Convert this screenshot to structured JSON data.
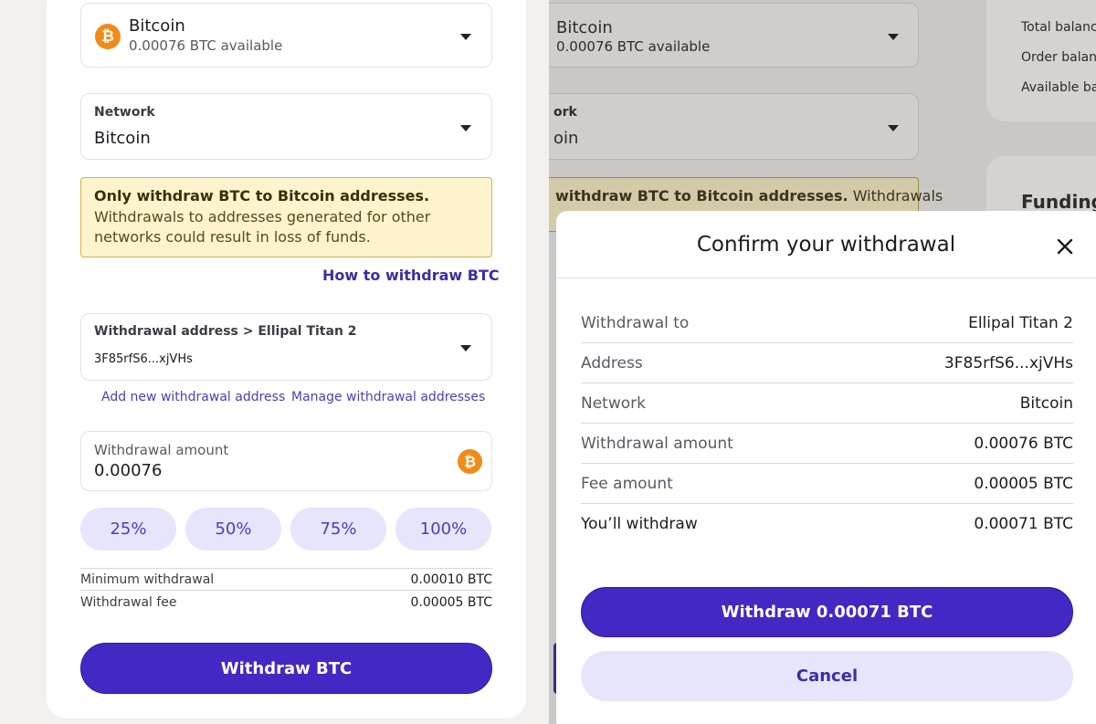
{
  "asset": {
    "name": "Bitcoin",
    "available": "0.00076 BTC available",
    "icon": "bitcoin-icon"
  },
  "network": {
    "label": "Network",
    "value": "Bitcoin"
  },
  "warning": {
    "bold": "Only withdraw BTC to Bitcoin addresses.",
    "text": " Withdrawals to addresses generated for other networks could result in loss of funds."
  },
  "how_to_link": "How to withdraw BTC",
  "address": {
    "label": "Withdrawal address > Ellipal Titan 2",
    "value": "3F85rfS6...xjVHs"
  },
  "address_links": {
    "add": "Add new withdrawal address",
    "manage": "Manage withdrawal addresses"
  },
  "amount": {
    "label": "Withdrawal amount",
    "value": "0.00076"
  },
  "percent_buttons": [
    "25%",
    "50%",
    "75%",
    "100%"
  ],
  "limits": {
    "min_label": "Minimum withdrawal",
    "min_value": "0.00010 BTC",
    "fee_label": "Withdrawal fee",
    "fee_value": "0.00005 BTC"
  },
  "withdraw_button": "Withdraw BTC",
  "background": {
    "asset_name": "Bitcoin",
    "asset_available": "0.00076 BTC available",
    "network_label": "ork",
    "network_value": "oin",
    "warning_bold": "withdraw BTC to Bitcoin addresses.",
    "warning_text": " Withdrawals",
    "balance_labels": [
      "Total balance",
      "Order balanc",
      "Available bal"
    ],
    "funding": "Funding"
  },
  "modal": {
    "title": "Confirm your withdrawal",
    "rows": [
      {
        "label": "Withdrawal to",
        "value": "Ellipal Titan 2"
      },
      {
        "label": "Address",
        "value": "3F85rfS6...xjVHs"
      },
      {
        "label": "Network",
        "value": "Bitcoin"
      },
      {
        "label": "Withdrawal amount",
        "value": "0.00076 BTC"
      },
      {
        "label": "Fee amount",
        "value": "0.00005 BTC"
      },
      {
        "label": "You’ll withdraw",
        "value": "0.00071 BTC"
      }
    ],
    "confirm_button": "Withdraw 0.00071 BTC",
    "cancel_button": "Cancel"
  },
  "colors": {
    "primary": "#4328c4",
    "primary_light": "#e7e5fb",
    "warning_bg": "#fdf4ce",
    "bitcoin": "#f28b1a"
  }
}
